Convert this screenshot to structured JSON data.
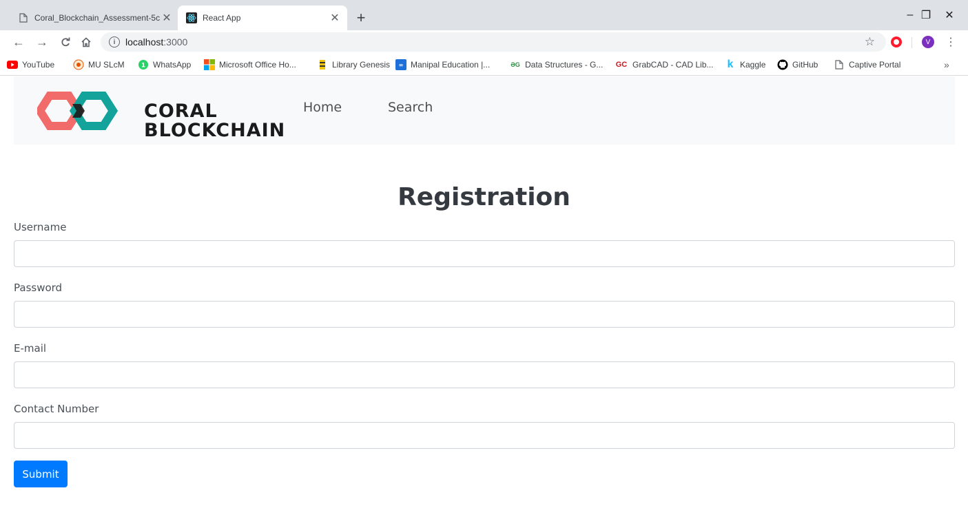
{
  "browser": {
    "tabs": [
      {
        "title": "Coral_Blockchain_Assessment-5c",
        "icon": "document-icon",
        "active": false
      },
      {
        "title": "React App",
        "icon": "react-icon",
        "active": true
      }
    ],
    "new_tab": "+",
    "window_controls": {
      "minimize": "–",
      "restore": "❐",
      "close": "✕"
    },
    "url": {
      "host": "localhost",
      "port": ":3000"
    }
  },
  "bookmarks": [
    {
      "label": "YouTube",
      "icon": "youtube-icon",
      "color": "#ff0000"
    },
    {
      "label": "MU SLcM",
      "icon": "mu-icon",
      "color": "#e65100"
    },
    {
      "label": "WhatsApp",
      "icon": "whatsapp-icon",
      "color": "#25d366"
    },
    {
      "label": "Microsoft Office Ho...",
      "icon": "microsoft-icon",
      "color": "#f25022"
    },
    {
      "label": "Library Genesis",
      "icon": "libgen-icon",
      "color": "#4a4a4a"
    },
    {
      "label": "Manipal Education |...",
      "icon": "manipal-icon",
      "color": "#1e6fd9"
    },
    {
      "label": "Data Structures - G...",
      "icon": "gfg-icon",
      "color": "#2f8d46"
    },
    {
      "label": "GrabCAD - CAD Lib...",
      "icon": "grabcad-icon",
      "color": "#c4161c"
    },
    {
      "label": "Kaggle",
      "icon": "kaggle-icon",
      "color": "#20beff"
    },
    {
      "label": "GitHub",
      "icon": "github-icon",
      "color": "#000000"
    },
    {
      "label": "Captive Portal",
      "icon": "document-icon",
      "color": "#5f6368"
    }
  ],
  "site": {
    "logo_line1": "CORAL",
    "logo_line2": "BLOCKCHAIN",
    "nav": [
      "Home",
      "Search"
    ],
    "colors": {
      "coral": "#f26b6b",
      "teal": "#14a39a",
      "primary": "#007bff"
    }
  },
  "form": {
    "title": "Registration",
    "fields": [
      {
        "label": "Username",
        "value": ""
      },
      {
        "label": "Password",
        "value": ""
      },
      {
        "label": "E-mail",
        "value": ""
      },
      {
        "label": "Contact Number",
        "value": ""
      }
    ],
    "submit": "Submit"
  }
}
